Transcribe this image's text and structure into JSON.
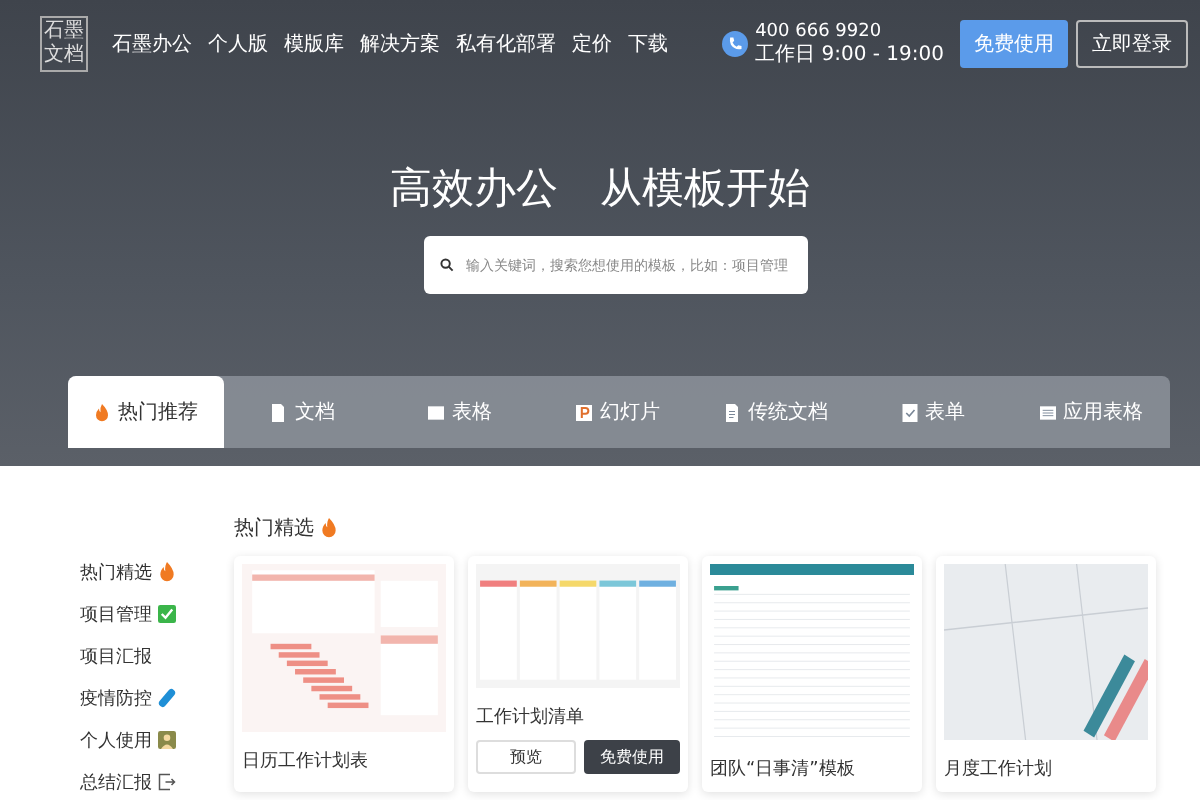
{
  "logo": {
    "lines": [
      "石墨",
      "文档"
    ]
  },
  "nav": [
    "石墨办公",
    "个人版",
    "模版库",
    "解决方案",
    "私有化部署",
    "定价",
    "下载"
  ],
  "contact": {
    "phone": "400 666 9920",
    "hours": "工作日 9:00 - 19:00"
  },
  "actions": [
    {
      "label": "免费使用",
      "kind": "primary"
    },
    {
      "label": "立即登录",
      "kind": "outline"
    }
  ],
  "hero": {
    "title": "高效办公　从模板开始",
    "search": {
      "placeholder": "输入关键词，搜索您想使用的模板，比如：项目管理"
    }
  },
  "tabs": [
    {
      "label": "热门推荐",
      "kind": "fire",
      "selected": true
    },
    {
      "label": "文档",
      "kind": "doc",
      "selected": false
    },
    {
      "label": "表格",
      "kind": "sheet",
      "selected": false
    },
    {
      "label": "幻灯片",
      "kind": "slide",
      "selected": false
    },
    {
      "label": "传统文档",
      "kind": "legacy",
      "selected": false
    },
    {
      "label": "表单",
      "kind": "form",
      "selected": false
    },
    {
      "label": "应用表格",
      "kind": "app",
      "selected": false
    }
  ],
  "sidebar": [
    {
      "label": "热门精选",
      "kind": "fire"
    },
    {
      "label": "项目管理",
      "kind": "check"
    },
    {
      "label": "项目汇报",
      "kind": "none"
    },
    {
      "label": "疫情防控",
      "kind": "pill"
    },
    {
      "label": "个人使用",
      "kind": "person"
    },
    {
      "label": "总结汇报",
      "kind": "export"
    }
  ],
  "section": {
    "title": "热门精选"
  },
  "cards": [
    {
      "title": "日历工作计划表",
      "kind": "gantt"
    },
    {
      "title": "工作计划清单",
      "kind": "columns",
      "buttons": [
        {
          "label": "预览",
          "kind": "outline"
        },
        {
          "label": "免费使用",
          "kind": "dark"
        }
      ]
    },
    {
      "title": "团队“日事清”模板",
      "kind": "sheet"
    },
    {
      "title": "月度工作计划",
      "kind": "photo"
    }
  ]
}
